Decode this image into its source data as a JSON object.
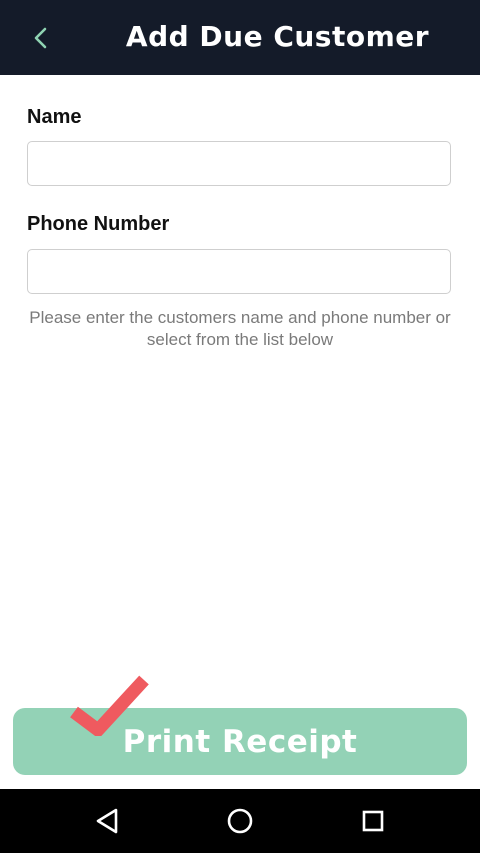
{
  "app_bar": {
    "title": "Add Due Customer",
    "back_icon": "chevron-left-icon",
    "background": "#141b29",
    "accent": "#8fd3b2"
  },
  "form": {
    "name_label": "Name",
    "name_value": "",
    "phone_label": "Phone Number",
    "phone_value": "",
    "helper_text_line1": "Please enter the customers name and phone number or",
    "helper_text_line2": "select from the list below"
  },
  "actions": {
    "print_label": "Print Receipt",
    "print_color": "#93d2b6",
    "check_icon": "checkmark-icon",
    "check_color": "#ef5a5f"
  },
  "system_nav": {
    "back_icon": "triangle-back-icon",
    "home_icon": "circle-home-icon",
    "recents_icon": "square-recents-icon"
  }
}
